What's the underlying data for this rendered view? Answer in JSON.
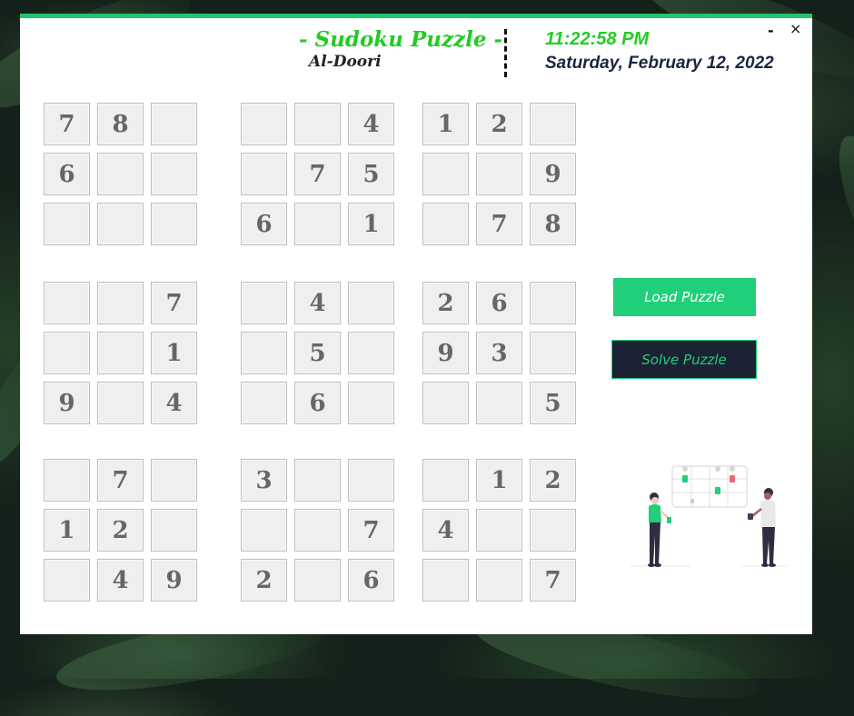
{
  "window": {
    "title": "- Sudoku Puzzle -",
    "author": "Al-Doori",
    "time": "11:22:58 PM",
    "date": "Saturday, February 12, 2022",
    "minimize_label": "-",
    "close_label": "×"
  },
  "grid": [
    [
      "7",
      "8",
      "",
      "",
      "",
      "4",
      "1",
      "2",
      ""
    ],
    [
      "6",
      "",
      "",
      "",
      "7",
      "5",
      "",
      "",
      "9"
    ],
    [
      "",
      "",
      "",
      "6",
      "",
      "1",
      "",
      "7",
      "8"
    ],
    [
      "",
      "",
      "7",
      "",
      "4",
      "",
      "2",
      "6",
      ""
    ],
    [
      "",
      "",
      "1",
      "",
      "5",
      "",
      "9",
      "3",
      ""
    ],
    [
      "9",
      "",
      "4",
      "",
      "6",
      "",
      "",
      "",
      "5"
    ],
    [
      "",
      "7",
      "",
      "3",
      "",
      "",
      "",
      "1",
      "2"
    ],
    [
      "1",
      "2",
      "",
      "",
      "",
      "7",
      "4",
      "",
      ""
    ],
    [
      "",
      "4",
      "9",
      "2",
      "",
      "6",
      "",
      "",
      "7"
    ]
  ],
  "buttons": {
    "load": "Load Puzzle",
    "solve": "Solve Puzzle"
  },
  "colors": {
    "accent": "#1ec66b",
    "title_green": "#22cc22",
    "dark_navy": "#1b2233"
  },
  "illustration": {
    "icon": "team-planning-board-illustration"
  }
}
